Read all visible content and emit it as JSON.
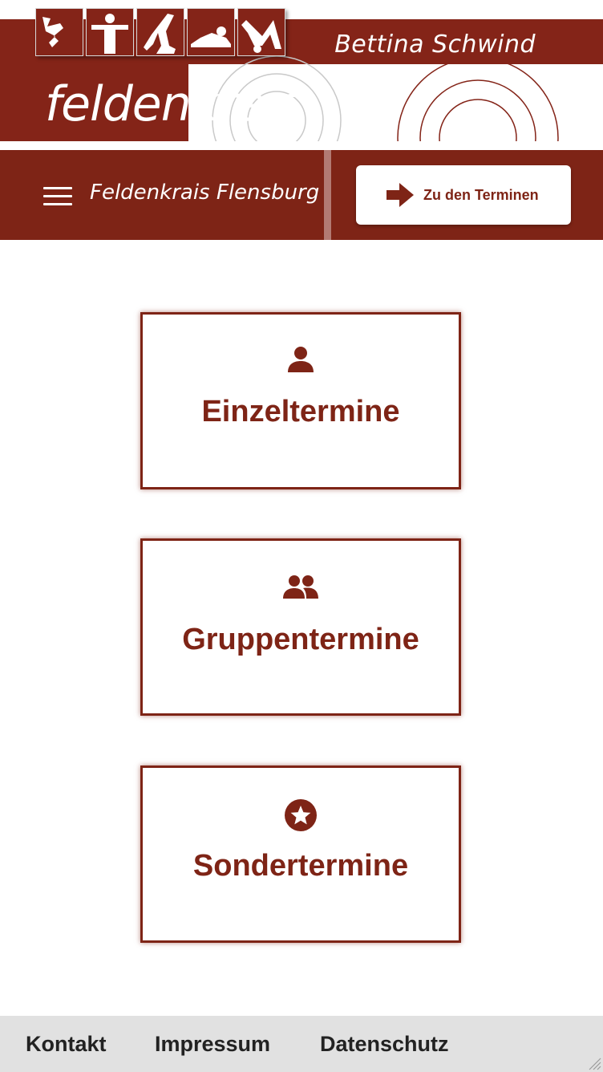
{
  "banner": {
    "author": "Bettina Schwind",
    "logo_text": "feldenkrais",
    "figure_icons": [
      "figure-reaching-icon",
      "figure-standing-icon",
      "figure-kneeling-icon",
      "figure-lying-icon",
      "figure-bridge-icon"
    ]
  },
  "nav": {
    "menu_icon": "hamburger-icon",
    "title": "Feldenkrais Flensburg",
    "cta_label": "Zu den Terminen",
    "cta_icon": "arrow-right-icon"
  },
  "cards": [
    {
      "label": "Einzeltermine",
      "icon": "user-icon"
    },
    {
      "label": "Gruppentermine",
      "icon": "users-icon"
    },
    {
      "label": "Sondertermine",
      "icon": "star-circle-icon"
    }
  ],
  "footer": {
    "links": [
      "Kontakt",
      "Impressum",
      "Datenschutz"
    ]
  },
  "colors": {
    "brand": "#7e2416",
    "banner": "#842418",
    "footer_bg": "#e1e1e1"
  }
}
